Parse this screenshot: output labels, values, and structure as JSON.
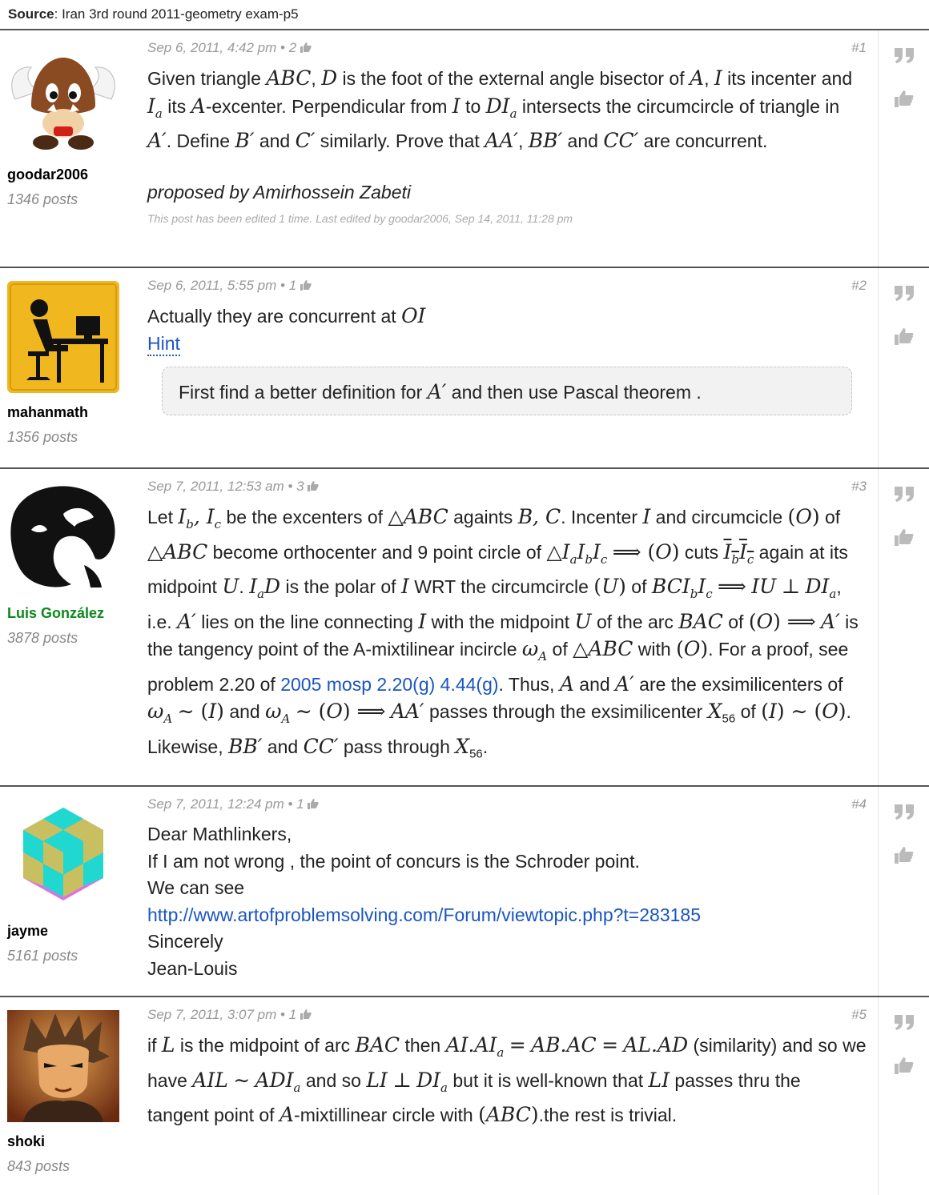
{
  "source": {
    "label": "Source",
    "text": ": Iran 3rd round 2011-geometry exam-p5"
  },
  "icons": {
    "thumb": "thumbs-up-icon",
    "quote": "quote-icon"
  },
  "colors": {
    "link": "#1a55c0",
    "green_user": "#0a8a1a",
    "meta": "#999999"
  },
  "posts": [
    {
      "user": {
        "name": "goodar2006",
        "posts": "1346 posts",
        "avatar": "winged-goomba-avatar"
      },
      "meta": "Sep 6, 2011, 4:42 pm • 2",
      "num": "#1",
      "proposed": "proposed by Amirhossein Zabeti",
      "edited": "This post has been edited 1 time. Last edited by goodar2006, Sep 14, 2011, 11:28 pm"
    },
    {
      "user": {
        "name": "mahanmath",
        "posts": "1356 posts",
        "avatar": "desk-worker-avatar"
      },
      "meta": "Sep 6, 2011, 5:55 pm • 1",
      "num": "#2",
      "hint": "Hint"
    },
    {
      "user": {
        "name": "Luis González",
        "posts": "3878 posts",
        "avatar": "face-sketch-avatar"
      },
      "meta": "Sep 7, 2011, 12:53 am • 3",
      "num": "#3",
      "link": "2005 mosp 2.20(g) 4.44(g)"
    },
    {
      "user": {
        "name": "jayme",
        "posts": "5161 posts",
        "avatar": "cube-pattern-avatar"
      },
      "meta": "Sep 7, 2011, 12:24 pm • 1",
      "num": "#4",
      "lines": [
        "Dear Mathlinkers,",
        "If I am not wrong , the point of concurs is the Schroder point.",
        "We can see"
      ],
      "url": "http://www.artofproblemsolving.com/Forum/viewtopic.php?t=283185",
      "closing": [
        "Sincerely",
        "Jean-Louis"
      ]
    },
    {
      "user": {
        "name": "shoki",
        "posts": "843 posts",
        "avatar": "anime-face-avatar"
      },
      "meta": "Sep 7, 2011, 3:07 pm • 1",
      "num": "#5"
    }
  ]
}
